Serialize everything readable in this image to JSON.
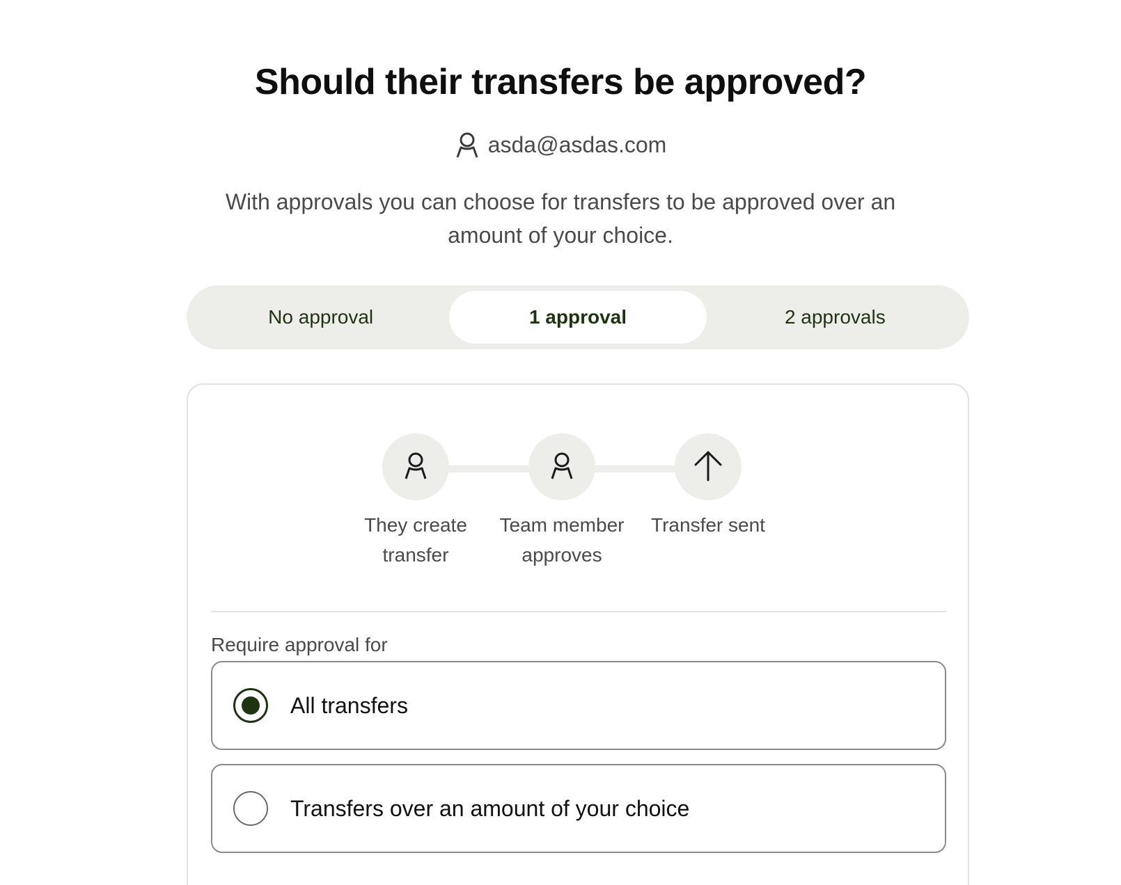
{
  "header": {
    "title": "Should their transfers be approved?",
    "user_email": "asda@asdas.com",
    "description": "With approvals you can choose for transfers to be approved over an amount of your choice."
  },
  "approval_levels": {
    "options": [
      "No approval",
      "1 approval",
      "2 approvals"
    ],
    "selected": "1 approval"
  },
  "flow": {
    "steps": [
      {
        "label": "They create transfer",
        "icon": "person-icon"
      },
      {
        "label": "Team member approves",
        "icon": "person-icon"
      },
      {
        "label": "Transfer sent",
        "icon": "arrow-up-icon"
      }
    ]
  },
  "requirement": {
    "label": "Require approval for",
    "options": [
      {
        "label": "All transfers",
        "checked": true
      },
      {
        "label": "Transfers over an amount of your choice",
        "checked": false
      }
    ]
  },
  "colors": {
    "accent": "#1f3311",
    "segment_bg": "#ededea",
    "border": "#e2e2e2"
  }
}
